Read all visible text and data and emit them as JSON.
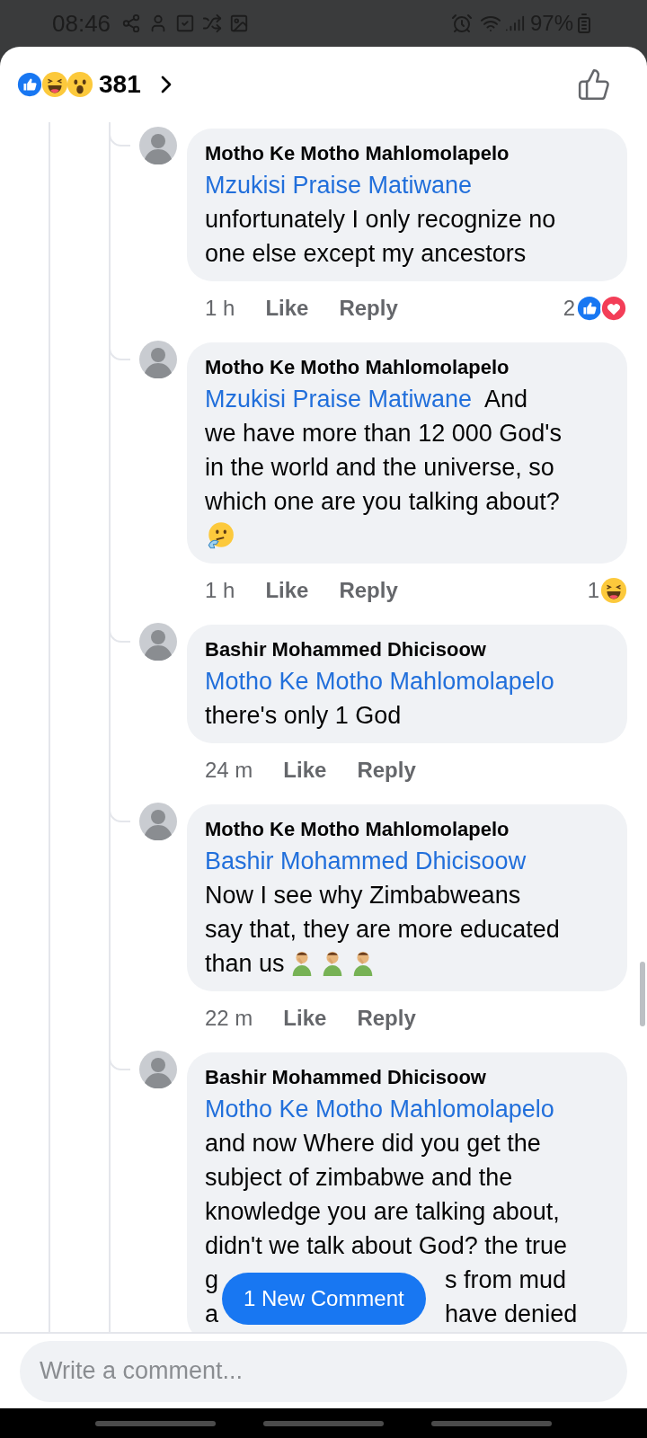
{
  "status_bar": {
    "time": "08:46",
    "battery": "97%"
  },
  "header": {
    "reactions": [
      {
        "kind": "like"
      },
      {
        "kind": "haha"
      },
      {
        "kind": "wow"
      }
    ],
    "count": "381"
  },
  "comments": [
    {
      "author": "Motho Ke Motho Mahlomolapelo",
      "mention": "Mzukisi Praise Matiwane",
      "lines": [
        "unfortunately I only recognize no",
        "one else except my ancestors"
      ],
      "time": "1 h",
      "like": "Like",
      "reply": "Reply",
      "reaction_count": "2",
      "reactions": [
        {
          "kind": "like"
        },
        {
          "kind": "love"
        }
      ]
    },
    {
      "author": "Motho Ke Motho Mahlomolapelo",
      "mention": "Mzukisi Praise Matiwane",
      "mention_tail": "And",
      "lines": [
        "we have more than 12 000 God's",
        "in the world and the universe, so",
        "which one are you talking about?"
      ],
      "emoji_line": [
        {
          "kind": "thinking"
        }
      ],
      "time": "1 h",
      "like": "Like",
      "reply": "Reply",
      "reaction_count": "1",
      "reactions": [
        {
          "kind": "haha"
        }
      ]
    },
    {
      "author": "Bashir Mohammed Dhicisoow",
      "mention": "Motho Ke Motho Mahlomolapelo",
      "lines": [
        "there's only 1 God"
      ],
      "time": "24 m",
      "like": "Like",
      "reply": "Reply"
    },
    {
      "author": "Motho Ke Motho Mahlomolapelo",
      "mention": "Bashir Mohammed Dhicisoow",
      "lines": [
        "Now I see why Zimbabweans",
        "say that, they are more educated",
        "than us"
      ],
      "trailing_emojis": [
        {
          "kind": "facepalm"
        },
        {
          "kind": "facepalm"
        },
        {
          "kind": "facepalm"
        }
      ],
      "time": "22 m",
      "like": "Like",
      "reply": "Reply"
    },
    {
      "author": "Bashir Mohammed Dhicisoow",
      "mention": "Motho Ke Motho Mahlomolapelo",
      "lines": [
        "and now Where did you get the",
        "subject of zimbabwe and the",
        "knowledge you are talking about,",
        "didn't we talk about God? the true"
      ],
      "split_lines": [
        {
          "left": "g",
          "right": "s from mud"
        },
        {
          "left": "a",
          "right": "have denied"
        }
      ]
    }
  ],
  "new_comment_pill": "1 New Comment",
  "composer": {
    "placeholder": "Write a comment..."
  }
}
